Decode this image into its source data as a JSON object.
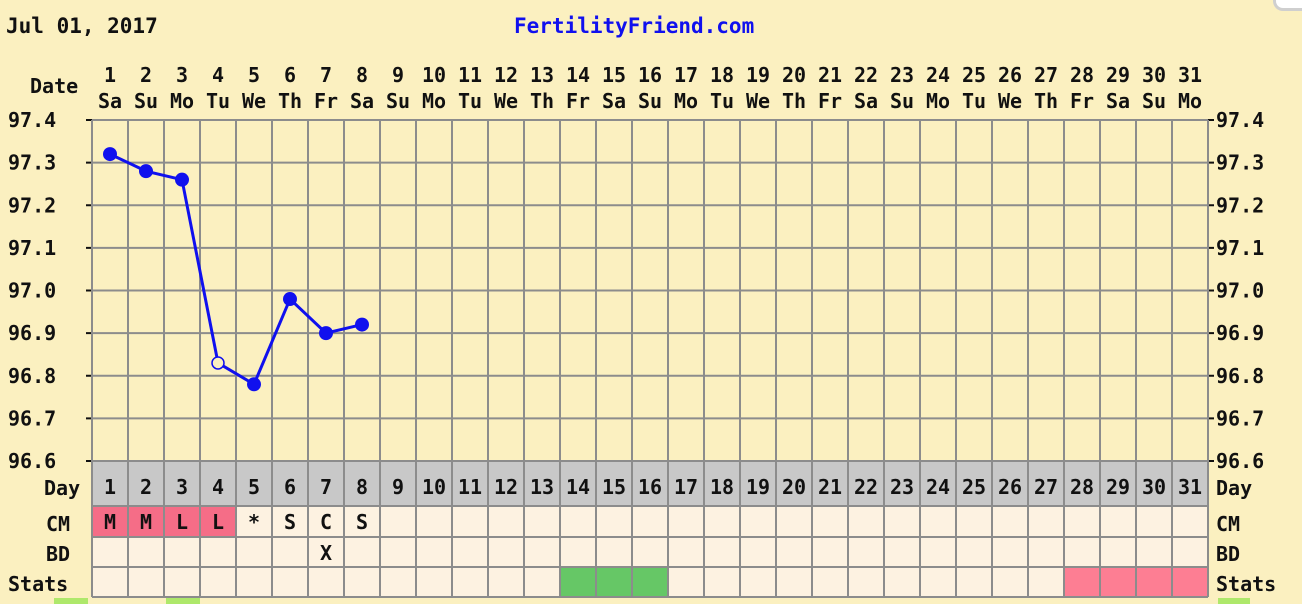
{
  "header": {
    "date_label": "Jul 01, 2017",
    "site_link": "FertilityFriend.com"
  },
  "row_labels": {
    "date": "Date",
    "day": "Day",
    "cm": "CM",
    "bd": "BD",
    "stats": "Stats"
  },
  "colors": {
    "background": "#fbf0c0",
    "grid": "#8c8c8c",
    "day_band": "#c8c8c8",
    "series": "#1010ee",
    "cm_menstrual": "#f56d87",
    "lower_row": "#fdf2e1",
    "green": "#66c766",
    "pink": "#fd7e93",
    "lime": "#aee86b"
  },
  "chart_data": {
    "type": "line",
    "days": [
      1,
      2,
      3,
      4,
      5,
      6,
      7,
      8,
      9,
      10,
      11,
      12,
      13,
      14,
      15,
      16,
      17,
      18,
      19,
      20,
      21,
      22,
      23,
      24,
      25,
      26,
      27,
      28,
      29,
      30,
      31
    ],
    "weekdays": [
      "Sa",
      "Su",
      "Mo",
      "Tu",
      "We",
      "Th",
      "Fr",
      "Sa",
      "Su",
      "Mo",
      "Tu",
      "We",
      "Th",
      "Fr",
      "Sa",
      "Su",
      "Mo",
      "Tu",
      "We",
      "Th",
      "Fr",
      "Sa",
      "Su",
      "Mo",
      "Tu",
      "We",
      "Th",
      "Fr",
      "Sa",
      "Su",
      "Mo"
    ],
    "y_ticks": [
      "97.4",
      "97.3",
      "97.2",
      "97.1",
      "97.0",
      "96.9",
      "96.8",
      "96.7",
      "96.6"
    ],
    "ylim": [
      96.6,
      97.4
    ],
    "series": [
      {
        "points": [
          {
            "day": 1,
            "value": 97.32,
            "open": false
          },
          {
            "day": 2,
            "value": 97.28,
            "open": false
          },
          {
            "day": 3,
            "value": 97.26,
            "open": false
          },
          {
            "day": 4,
            "value": 96.83,
            "open": true
          },
          {
            "day": 5,
            "value": 96.78,
            "open": false
          },
          {
            "day": 6,
            "value": 96.98,
            "open": false
          },
          {
            "day": 7,
            "value": 96.9,
            "open": false
          },
          {
            "day": 8,
            "value": 96.92,
            "open": false
          }
        ]
      }
    ],
    "cm": [
      {
        "day": 1,
        "text": "M",
        "menstrual": true
      },
      {
        "day": 2,
        "text": "M",
        "menstrual": true
      },
      {
        "day": 3,
        "text": "L",
        "menstrual": true
      },
      {
        "day": 4,
        "text": "L",
        "menstrual": true
      },
      {
        "day": 5,
        "text": "*",
        "menstrual": false
      },
      {
        "day": 6,
        "text": "S",
        "menstrual": false
      },
      {
        "day": 7,
        "text": "C",
        "menstrual": false
      },
      {
        "day": 8,
        "text": "S",
        "menstrual": false
      }
    ],
    "bd": [
      {
        "day": 7,
        "text": "X"
      }
    ],
    "stats": {
      "green_days": [
        14,
        15,
        16
      ],
      "pink_days": [
        28,
        29,
        30,
        31
      ]
    }
  }
}
